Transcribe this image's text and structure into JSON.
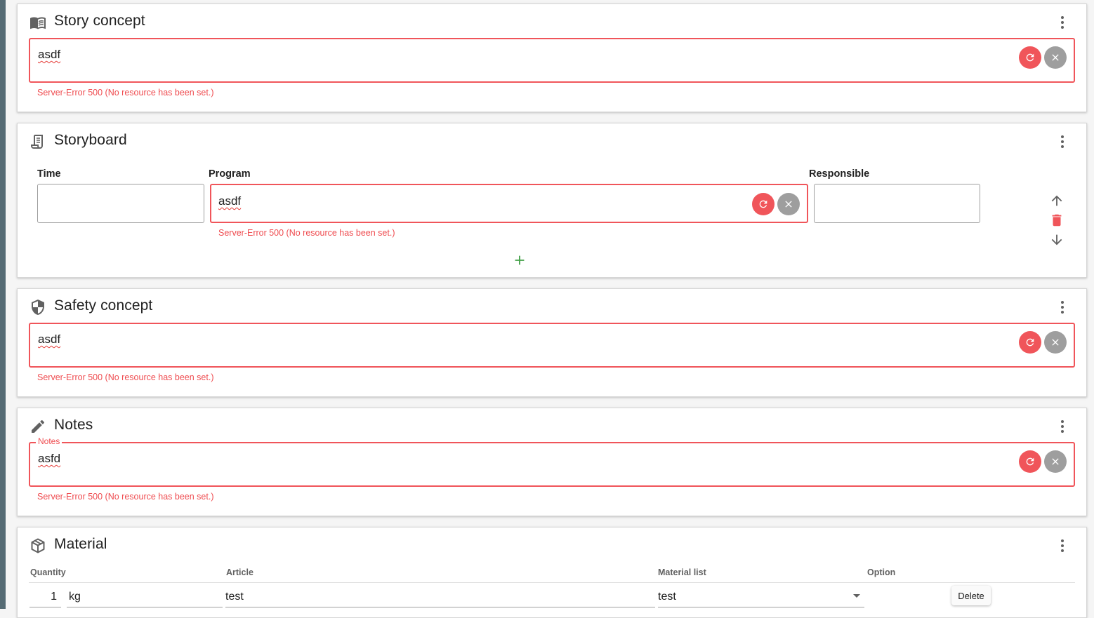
{
  "error_message": "Server-Error 500 (No resource has been set.)",
  "story_concept": {
    "title": "Story concept",
    "icon": "book-open-icon",
    "value": "asdf"
  },
  "storyboard": {
    "title": "Storyboard",
    "icon": "script-icon",
    "columns": {
      "time": "Time",
      "program": "Program",
      "responsible": "Responsible"
    },
    "row": {
      "time": "",
      "program": "asdf",
      "responsible": ""
    }
  },
  "safety_concept": {
    "title": "Safety concept",
    "icon": "shield-icon",
    "value": "asdf"
  },
  "notes": {
    "title": "Notes",
    "icon": "pencil-icon",
    "legend": "Notes",
    "value": "asfd"
  },
  "material": {
    "title": "Material",
    "icon": "cube-icon",
    "columns": {
      "quantity": "Quantity",
      "article": "Article",
      "material_list": "Material list",
      "option": "Option"
    },
    "row": {
      "quantity": "1",
      "unit": "kg",
      "article": "test",
      "material_list": "test",
      "delete_label": "Delete"
    }
  },
  "colors": {
    "error": "#f0555a",
    "clear_button": "#9e9e9e",
    "add_green": "#43a047",
    "delete_red": "#f0555a"
  }
}
